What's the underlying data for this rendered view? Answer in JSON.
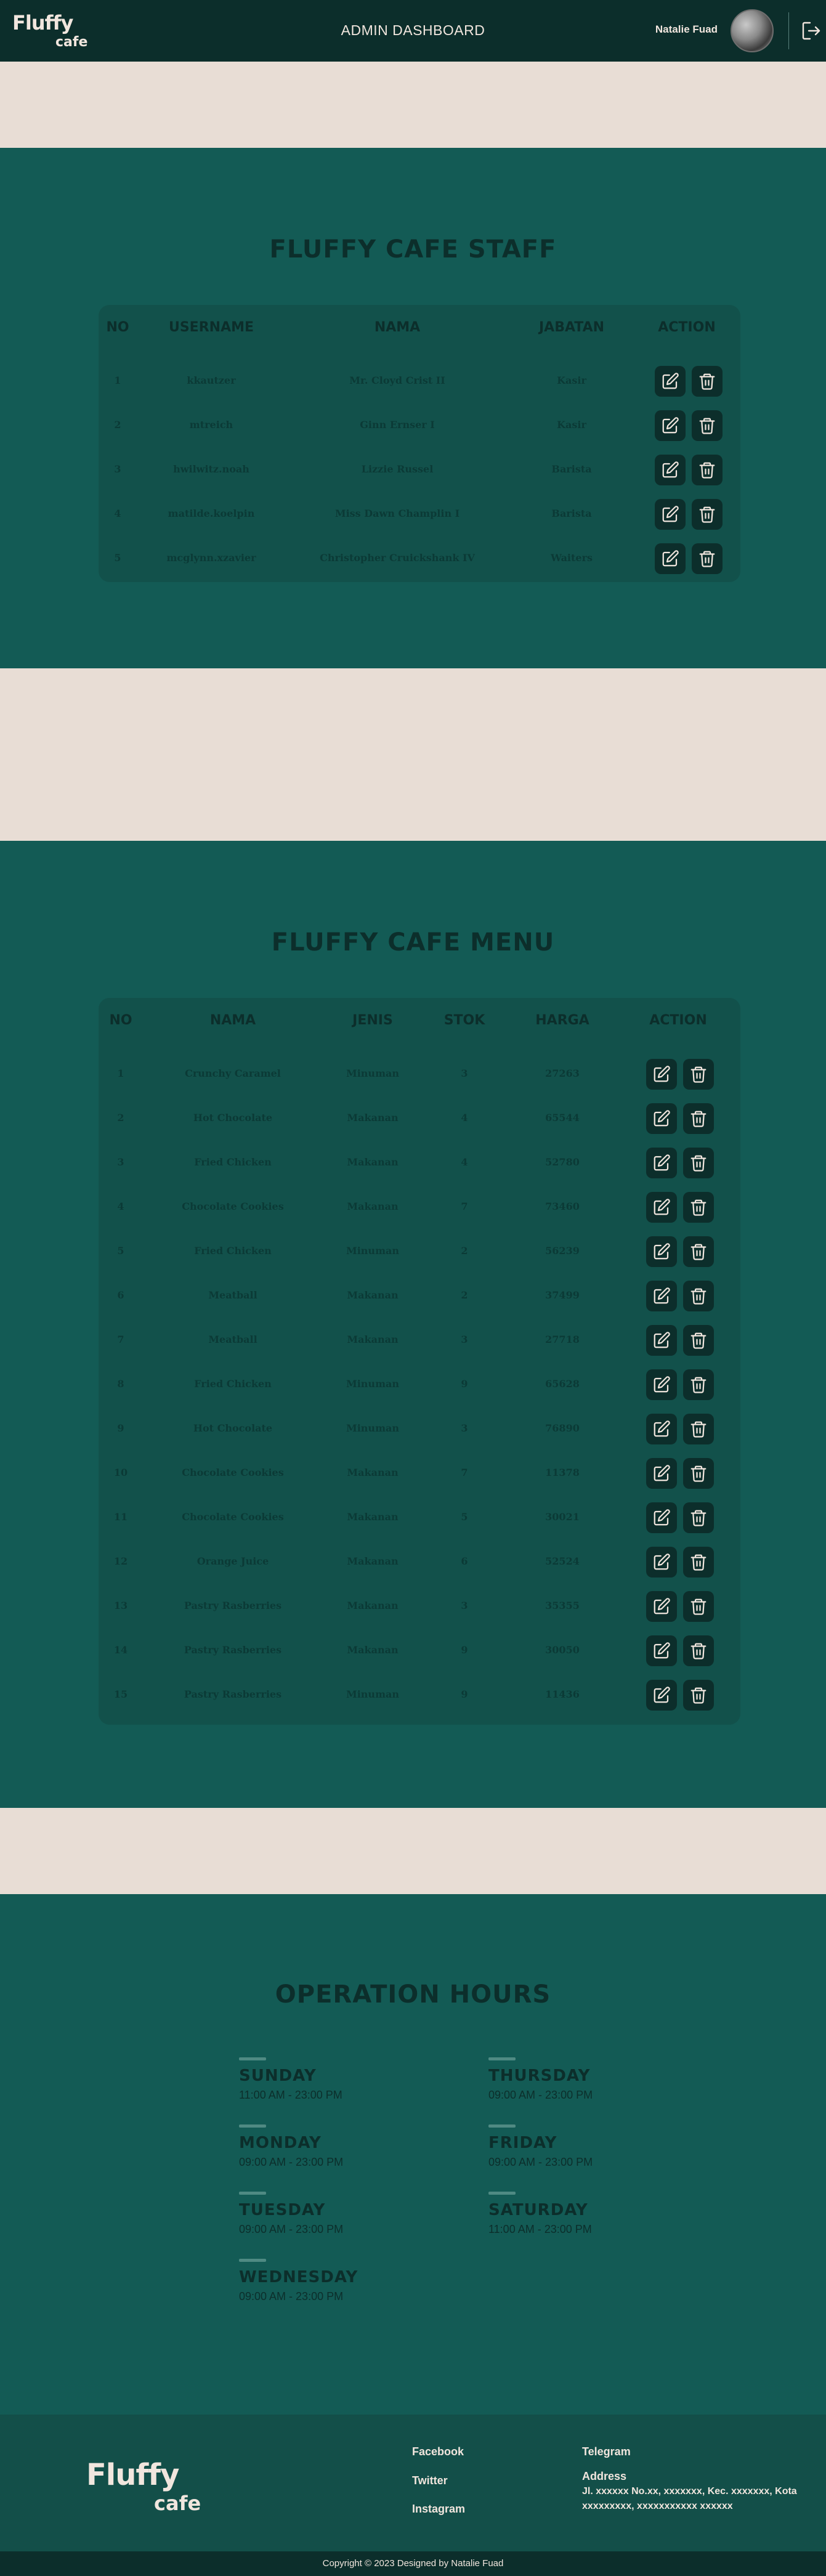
{
  "header": {
    "logo_line1": "Fluffy",
    "logo_line2": "cafe",
    "title": "ADMIN DASHBOARD",
    "user_name": "Natalie Fuad",
    "logout_icon": "logout-icon"
  },
  "staff": {
    "title": "FLUFFY CAFE STAFF",
    "columns": [
      "NO",
      "USERNAME",
      "NAMA",
      "JABATAN",
      "ACTION"
    ],
    "rows": [
      {
        "no": "1",
        "username": "kkautzer",
        "nama": "Mr. Cloyd Crist II",
        "jabatan": "Kasir"
      },
      {
        "no": "2",
        "username": "mtreich",
        "nama": "Ginn Ernser I",
        "jabatan": "Kasir"
      },
      {
        "no": "3",
        "username": "hwilwitz.noah",
        "nama": "Lizzie Russel",
        "jabatan": "Barista"
      },
      {
        "no": "4",
        "username": "matilde.koelpin",
        "nama": "Miss Dawn Champlin I",
        "jabatan": "Barista"
      },
      {
        "no": "5",
        "username": "mcglynn.xzavier",
        "nama": "Christopher Cruickshank IV",
        "jabatan": "Waiters"
      }
    ]
  },
  "menu": {
    "title": "FLUFFY CAFE MENU",
    "columns": [
      "NO",
      "NAMA",
      "JENIS",
      "STOK",
      "HARGA",
      "ACTION"
    ],
    "rows": [
      {
        "no": "1",
        "nama": "Crunchy Caramel",
        "jenis": "Minuman",
        "stok": "3",
        "harga": "27263"
      },
      {
        "no": "2",
        "nama": "Hot Chocolate",
        "jenis": "Makanan",
        "stok": "4",
        "harga": "65544"
      },
      {
        "no": "3",
        "nama": "Fried Chicken",
        "jenis": "Makanan",
        "stok": "4",
        "harga": "52780"
      },
      {
        "no": "4",
        "nama": "Chocolate Cookies",
        "jenis": "Makanan",
        "stok": "7",
        "harga": "73460"
      },
      {
        "no": "5",
        "nama": "Fried Chicken",
        "jenis": "Minuman",
        "stok": "2",
        "harga": "56239"
      },
      {
        "no": "6",
        "nama": "Meatball",
        "jenis": "Makanan",
        "stok": "2",
        "harga": "37499"
      },
      {
        "no": "7",
        "nama": "Meatball",
        "jenis": "Makanan",
        "stok": "3",
        "harga": "27718"
      },
      {
        "no": "8",
        "nama": "Fried Chicken",
        "jenis": "Minuman",
        "stok": "9",
        "harga": "65628"
      },
      {
        "no": "9",
        "nama": "Hot Chocolate",
        "jenis": "Minuman",
        "stok": "3",
        "harga": "76890"
      },
      {
        "no": "10",
        "nama": "Chocolate Cookies",
        "jenis": "Makanan",
        "stok": "7",
        "harga": "11378"
      },
      {
        "no": "11",
        "nama": "Chocolate Cookies",
        "jenis": "Makanan",
        "stok": "5",
        "harga": "30021"
      },
      {
        "no": "12",
        "nama": "Orange Juice",
        "jenis": "Makanan",
        "stok": "6",
        "harga": "52524"
      },
      {
        "no": "13",
        "nama": "Pastry Rasberries",
        "jenis": "Makanan",
        "stok": "3",
        "harga": "35355"
      },
      {
        "no": "14",
        "nama": "Pastry Rasberries",
        "jenis": "Makanan",
        "stok": "9",
        "harga": "30050"
      },
      {
        "no": "15",
        "nama": "Pastry Rasberries",
        "jenis": "Minuman",
        "stok": "9",
        "harga": "11436"
      }
    ]
  },
  "hours": {
    "title": "OPERATION HOURS",
    "days": [
      {
        "name": "SUNDAY",
        "time": "11:00 AM - 23:00 PM"
      },
      {
        "name": "THURSDAY",
        "time": "09:00 AM - 23:00 PM"
      },
      {
        "name": "MONDAY",
        "time": "09:00 AM - 23:00 PM"
      },
      {
        "name": "FRIDAY",
        "time": "09:00 AM - 23:00 PM"
      },
      {
        "name": "TUESDAY",
        "time": "09:00 AM - 23:00 PM"
      },
      {
        "name": "SATURDAY",
        "time": "11:00 AM - 23:00 PM"
      },
      {
        "name": "WEDNESDAY",
        "time": "09:00 AM - 23:00 PM"
      }
    ]
  },
  "footer": {
    "logo_line1": "Fluffy",
    "logo_line2": "cafe",
    "links": [
      "Facebook",
      "Twitter",
      "Instagram",
      "Telegram"
    ],
    "address_title": "Address",
    "address": "Jl. xxxxxx No.xx, xxxxxxx, Kec. xxxxxxx, Kota xxxxxxxxx, xxxxxxxxxxx xxxxxx",
    "copyright": "Copyright © 2023 Designed by Natalie Fuad"
  },
  "colors": {
    "dark": "#0c2e2b",
    "section": "#135b55",
    "card": "#12514b",
    "cream": "#e8ddd5"
  }
}
